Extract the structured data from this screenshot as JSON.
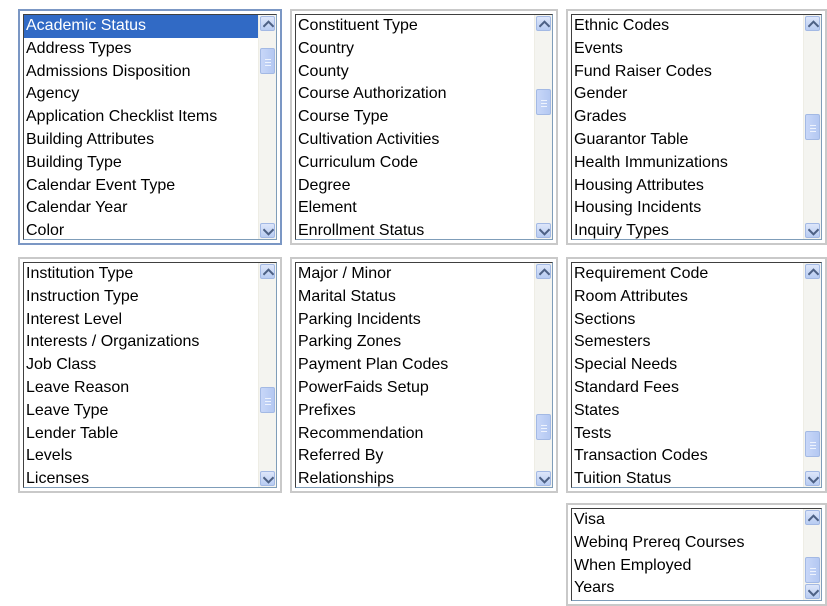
{
  "lists": [
    {
      "items": [
        "Academic Status",
        "Address Types",
        "Admissions Disposition",
        "Agency",
        "Application Checklist Items",
        "Building Attributes",
        "Building Type",
        "Calendar Event Type",
        "Calendar Year",
        "Color"
      ],
      "selected": "Academic Status",
      "scroll_position": 0.1
    },
    {
      "items": [
        "Constituent Type",
        "Country",
        "County",
        "Course Authorization",
        "Course Type",
        "Cultivation Activities",
        "Curriculum Code",
        "Degree",
        "Element",
        "Enrollment Status"
      ],
      "scroll_position": 0.35
    },
    {
      "items": [
        "Ethnic Codes",
        "Events",
        "Fund Raiser Codes",
        "Gender",
        "Grades",
        "Guarantor Table",
        "Health Immunizations",
        "Housing Attributes",
        "Housing Incidents",
        "Inquiry Types"
      ],
      "scroll_position": 0.5
    },
    {
      "items": [
        "Institution Type",
        "Instruction Type",
        "Interest Level",
        "Interests / Organizations",
        "Job Class",
        "Leave Reason",
        "Leave Type",
        "Lender Table",
        "Levels",
        "Licenses"
      ],
      "scroll_position": 0.65
    },
    {
      "items": [
        "Major / Minor",
        "Marital Status",
        "Parking Incidents",
        "Parking Zones",
        "Payment Plan Codes",
        "PowerFaids Setup",
        "Prefixes",
        "Recommendation",
        "Referred By",
        "Relationships"
      ],
      "scroll_position": 0.82
    },
    {
      "items": [
        "Requirement Code",
        "Room Attributes",
        "Sections",
        "Semesters",
        "Special Needs",
        "Standard Fees",
        "States",
        "Tests",
        "Transaction Codes",
        "Tuition Status"
      ],
      "scroll_position": 0.92
    },
    {
      "items": [
        "Visa",
        "Webinq Prereq Courses",
        "When Employed",
        "Years"
      ],
      "scroll_position": 1.0
    }
  ],
  "icons": {
    "up": "scroll-up-arrow-icon",
    "down": "scroll-down-arrow-icon"
  }
}
